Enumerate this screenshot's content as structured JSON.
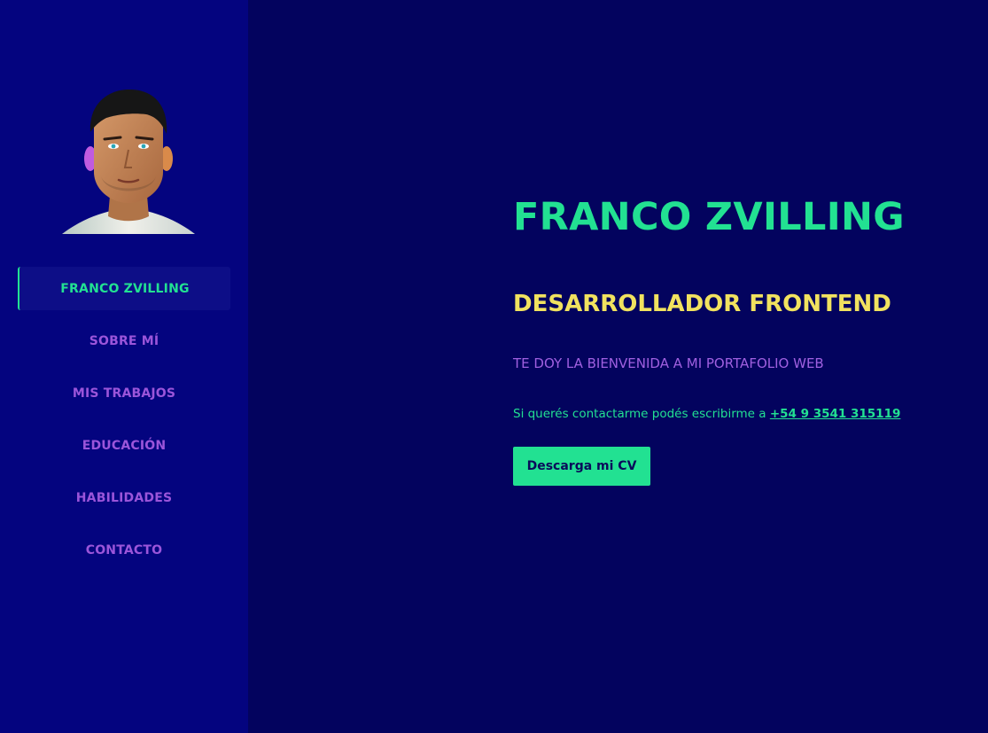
{
  "sidebar": {
    "items": [
      {
        "label": "FRANCO ZVILLING",
        "active": true
      },
      {
        "label": "SOBRE MÍ"
      },
      {
        "label": "MIS TRABAJOS"
      },
      {
        "label": "EDUCACIÓN"
      },
      {
        "label": "HABILIDADES"
      },
      {
        "label": "CONTACTO"
      }
    ]
  },
  "hero": {
    "name": "FRANCO ZVILLING",
    "role": "DESARROLLADOR FRONTEND",
    "welcome": "TE DOY LA BIENVENIDA A MI PORTAFOLIO WEB",
    "contact_text": "Si querés contactarme podés escribirme a ",
    "phone": "+54 9 3541 315119",
    "cv_button": "Descarga mi CV"
  },
  "colors": {
    "background": "#03035e",
    "sidebar": "#04047f",
    "accent_green": "#22e192",
    "accent_yellow": "#f1e25f",
    "accent_purple": "#9b55da"
  }
}
